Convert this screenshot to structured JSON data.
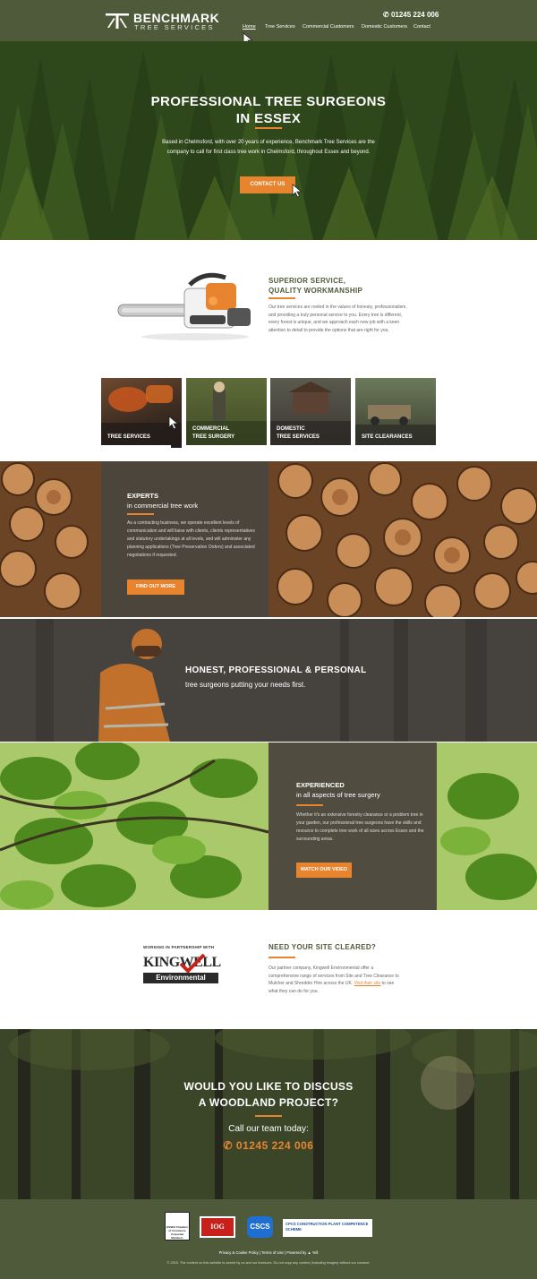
{
  "header": {
    "brand_name": "BENCHMARK",
    "brand_sub": "TREE SERVICES",
    "phone": "01245 224 006",
    "nav": [
      "Home",
      "Tree Services",
      "Commercial Customers",
      "Domestic Customers",
      "Contact"
    ]
  },
  "hero": {
    "title_line1": "PROFESSIONAL TREE SURGEONS",
    "title_line2": "IN ESSEX",
    "description": "Based in Chelmsford, with over 20 years of experience, Benchmark Tree Services are the company to call for first class tree work in Chelmsford, throughout Essex and beyond.",
    "button": "CONTACT US"
  },
  "intro": {
    "title_line1": "SUPERIOR SERVICE,",
    "title_line2": "QUALITY WORKMANSHIP",
    "text": "Our tree services are rooted in the values of honesty, professionalism, and providing a truly personal service to you. Every tree is different, every forest is unique, and we approach each new job with a keen attention to detail to provide the options that are right for you."
  },
  "tiles": [
    {
      "line1": "TREE SERVICES",
      "line2": ""
    },
    {
      "line1": "COMMERCIAL",
      "line2": "TREE SURGERY"
    },
    {
      "line1": "DOMESTIC",
      "line2": "TREE SERVICES"
    },
    {
      "line1": "SITE CLEARANCES",
      "line2": ""
    }
  ],
  "experts": {
    "title": "EXPERTS",
    "subtitle": "in commercial tree work",
    "text": "As a contracting business, we operate excellent levels of communication and will liaise with clients, clients representatives and statutory undertakings at all levels, and will administer any planning applications (Tree Preservation Orders) and associated negotiations if requested.",
    "button": "FIND OUT MORE"
  },
  "honest": {
    "title": "HONEST, PROFESSIONAL & PERSONAL",
    "subtitle": "tree surgeons putting your needs first."
  },
  "experienced": {
    "title": "EXPERIENCED",
    "subtitle": "in all aspects of tree surgery",
    "text": "Whether it's an extensive forestry clearance or a problem tree in your garden, our professional tree surgeons have the skills and resource to complete tree work of all sizes across Essex and the surrounding areas.",
    "button": "WATCH OUR VIDEO"
  },
  "partner": {
    "label": "WORKING IN PARTNERSHIP WITH",
    "logo_top": "KINGWELL",
    "logo_bottom": "Environmental",
    "title": "NEED YOUR SITE CLEARED?",
    "text": "Our partner company, Kingwell Environmental offer a comprehensive range of services from Site and Tree Clearance to Mulcher and Shredder Hire across the UK.",
    "link": "Visit their site",
    "text_after": " to see what they can do for you."
  },
  "woodland": {
    "title_line1": "WOULD YOU LIKE TO DISCUSS",
    "title_line2": "A WOODLAND PROJECT?",
    "call": "Call our team today:",
    "phone": "01245 224 006"
  },
  "footer": {
    "badges": [
      "ESSEX Chamber of Commerce Corporate Members",
      "IOG",
      "CSCS",
      "CPCS CONSTRUCTION PLANT COMPETENCE SCHEME"
    ],
    "links": "Privacy & Cookie Policy  |  Terms of Use  |  Powered by",
    "yell": "Yell",
    "copyright": "© 2015. The content on this website is owned by us and our licensors. Do not copy any content (including images) without our consent."
  },
  "colors": {
    "brand_green": "#4f5a3a",
    "accent_orange": "#e8842e"
  }
}
